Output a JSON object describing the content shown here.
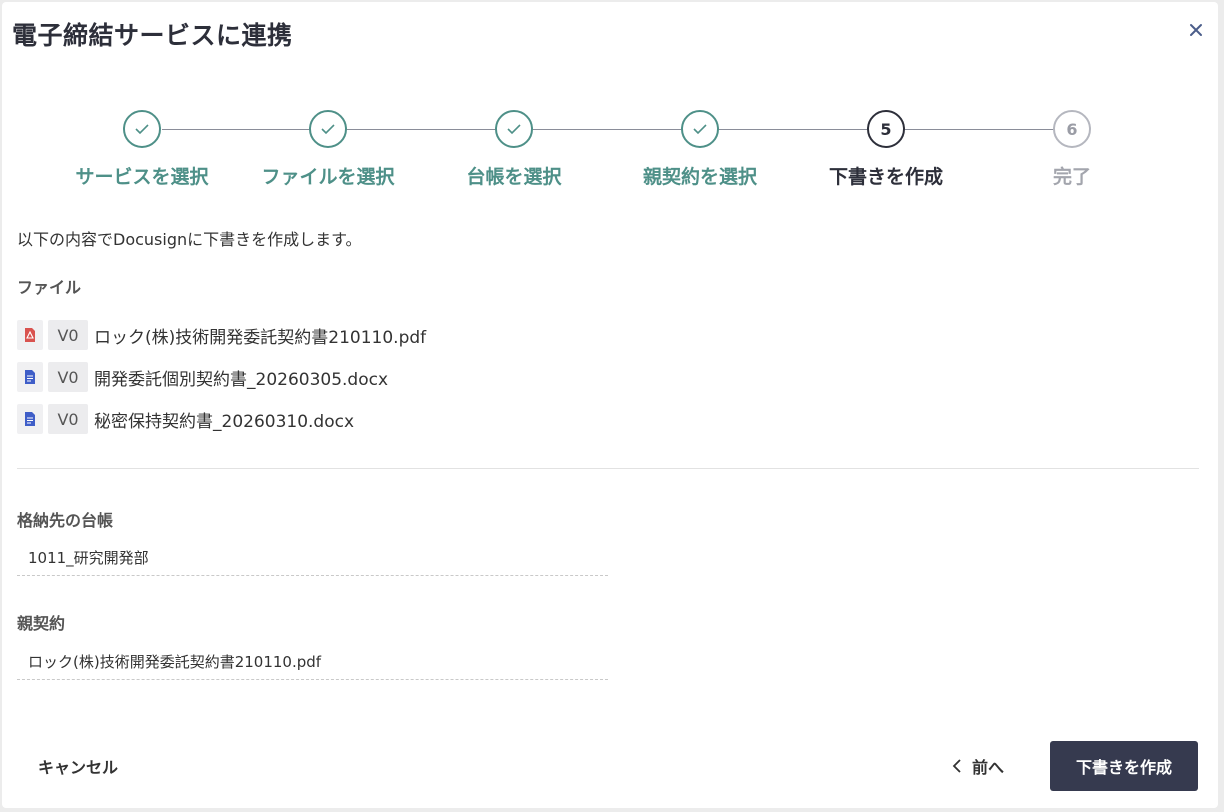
{
  "dialog": {
    "title": "電子締結サービスに連携",
    "close_icon": "close-icon"
  },
  "stepper": {
    "steps": [
      {
        "label": "サービスを選択",
        "number": "1",
        "status": "done"
      },
      {
        "label": "ファイルを選択",
        "number": "2",
        "status": "done"
      },
      {
        "label": "台帳を選択",
        "number": "3",
        "status": "done"
      },
      {
        "label": "親契約を選択",
        "number": "4",
        "status": "done"
      },
      {
        "label": "下書きを作成",
        "number": "5",
        "status": "current"
      },
      {
        "label": "完了",
        "number": "6",
        "status": "todo"
      }
    ],
    "colors": {
      "done": "#4e9088",
      "current": "#2d2f3a",
      "todo": "#a3a5ad"
    }
  },
  "intro": "以下の内容でDocusignに下書きを作成します。",
  "files": {
    "label": "ファイル",
    "items": [
      {
        "icon": "pdf-file-icon",
        "version": "V0",
        "name": "ロック(株)技術開発委託契約書210110.pdf"
      },
      {
        "icon": "word-file-icon",
        "version": "V0",
        "name": "開発委託個別契約書_20260305.docx"
      },
      {
        "icon": "word-file-icon",
        "version": "V0",
        "name": "秘密保持契約書_20260310.docx"
      }
    ]
  },
  "ledger": {
    "label": "格納先の台帳",
    "value": "1011_研究開発部"
  },
  "parent_contract": {
    "label": "親契約",
    "value": "ロック(株)技術開発委託契約書210110.pdf"
  },
  "footer": {
    "cancel_label": "キャンセル",
    "prev_label": "前へ",
    "create_label": "下書きを作成",
    "primary_color": "#363a4f"
  }
}
